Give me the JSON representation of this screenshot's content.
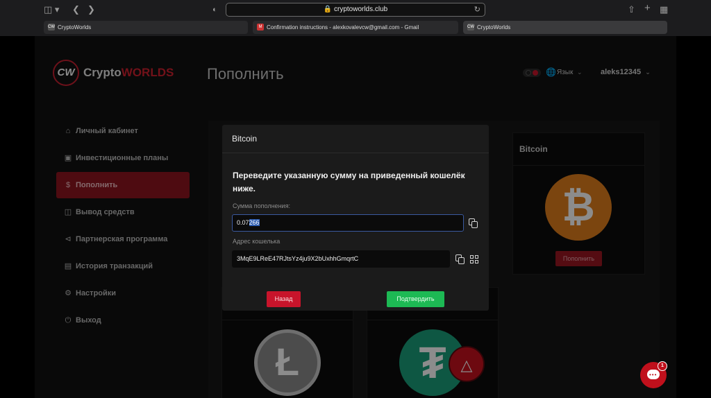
{
  "browser": {
    "url": "cryptoworlds.club",
    "tabs": [
      {
        "label": "CryptoWorlds",
        "active": false
      },
      {
        "label": "Confirmation instructions - alexkovalevcw@gmail.com - Gmail",
        "active": false
      },
      {
        "label": "CryptoWorlds",
        "active": true
      }
    ]
  },
  "header": {
    "logo_part1": "Crypto",
    "logo_part2": "WORLDS",
    "logo_mark": "CW",
    "page_title": "Пополнить",
    "language_label": "Язык",
    "username": "aleks12345"
  },
  "sidebar": {
    "items": [
      {
        "label": "Личный кабинет",
        "icon": "home-icon",
        "active": false
      },
      {
        "label": "Инвестиционные планы",
        "icon": "briefcase-icon",
        "active": false
      },
      {
        "label": "Пополнить",
        "icon": "dollar-icon",
        "active": true
      },
      {
        "label": "Вывод средств",
        "icon": "withdraw-icon",
        "active": false
      },
      {
        "label": "Партнерская программа",
        "icon": "share-icon",
        "active": false
      },
      {
        "label": "История транзакций",
        "icon": "history-icon",
        "active": false
      },
      {
        "label": "Настройки",
        "icon": "gear-icon",
        "active": false
      },
      {
        "label": "Выход",
        "icon": "power-icon",
        "active": false
      }
    ]
  },
  "cards": [
    {
      "title": "Bitcoin",
      "button": "Пополнить",
      "icon": "bitcoin-icon"
    },
    {
      "icon": "litecoin-icon"
    },
    {
      "icon": "tether-icon",
      "overlay_icon": "tron-icon"
    }
  ],
  "modal": {
    "title": "Bitcoin",
    "message": "Переведите указанную сумму на приведенный кошелёк ниже.",
    "amount_label": "Сумма пополнения:",
    "amount_value_pre": "0.07",
    "amount_value_sel": "266",
    "wallet_label": "Адрес кошелька",
    "wallet_value": "3MqE9LReE47RJtsYz4ju9X2bUxhhGmqrtC",
    "back_label": "Назад",
    "confirm_label": "Подтвердить"
  },
  "chat": {
    "badge": "1"
  },
  "colors": {
    "accent": "#c8142b",
    "confirm": "#1db954",
    "bitcoin": "#e07f1d"
  }
}
